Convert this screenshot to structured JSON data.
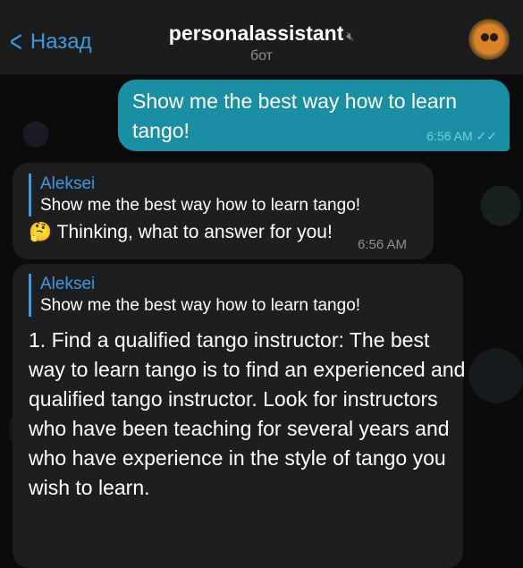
{
  "header": {
    "back_label": "Назад",
    "title": "personalassistant",
    "subtitle": "бот"
  },
  "messages": [
    {
      "type": "outgoing",
      "text": "Show me the best way how to learn tango!",
      "time": "6:56 AM"
    },
    {
      "type": "incoming",
      "reply_name": "Aleksei",
      "reply_text": "Show me the best way how to learn tango!",
      "emoji": "🤔",
      "text": "Thinking, what to answer for you!",
      "time": "6:56 AM"
    },
    {
      "type": "incoming",
      "reply_name": "Aleksei",
      "reply_text": "Show me the best way how to learn tango!",
      "text": "1. Find a qualified tango instructor: The best way to learn tango is to find an experienced and qualified tango instructor. Look for instructors who have been teaching for several years and who have experience in the style of tango you wish to learn."
    }
  ]
}
